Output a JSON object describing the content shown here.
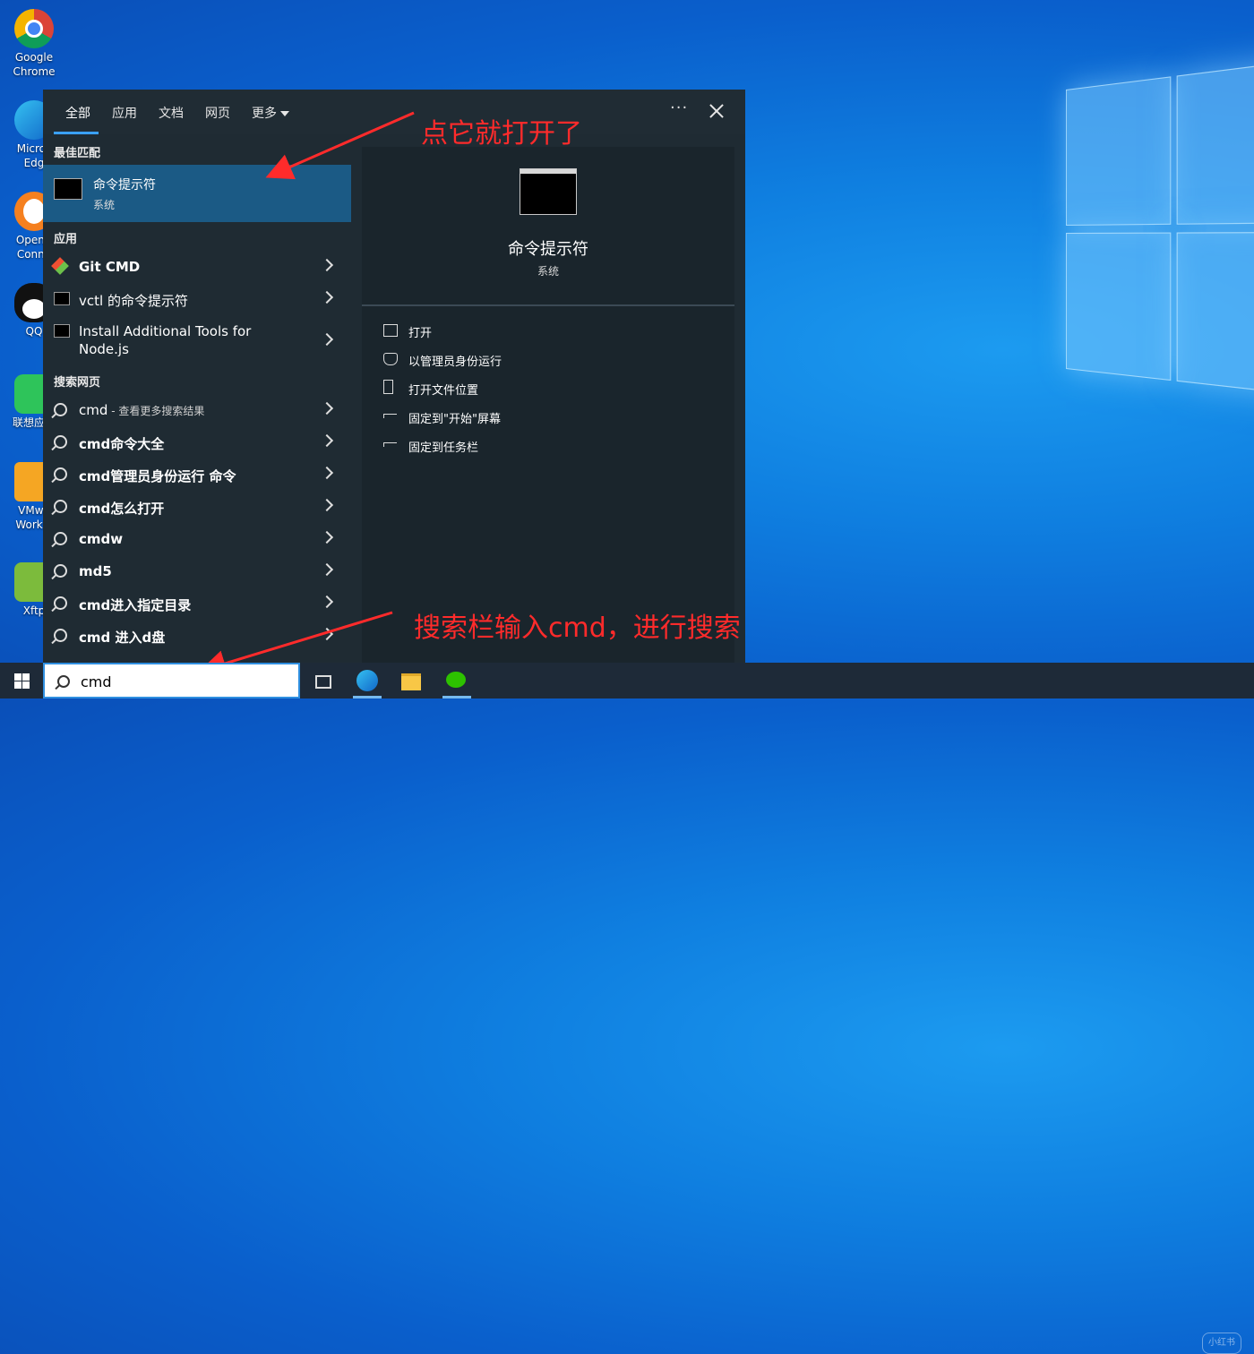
{
  "desktop": {
    "icons": [
      {
        "label": "Google Chrome"
      },
      {
        "label": "Micros Edg"
      },
      {
        "label": "OpenV Conne"
      },
      {
        "label": "QQ"
      },
      {
        "label": "联想应用"
      },
      {
        "label": "VMwa Workst"
      },
      {
        "label": "Xftp"
      }
    ]
  },
  "search_panel": {
    "tabs": [
      {
        "label": "全部",
        "active": true
      },
      {
        "label": "应用"
      },
      {
        "label": "文档"
      },
      {
        "label": "网页"
      },
      {
        "label": "更多"
      }
    ],
    "ellipsis": "···",
    "best_match": {
      "header": "最佳匹配",
      "title": "命令提示符",
      "subtitle": "系统"
    },
    "apps": {
      "header": "应用",
      "items": [
        {
          "label_bold": "Git CMD",
          "icon": "git-icon"
        },
        {
          "label": "vctl 的命令提示符",
          "icon": "cmd-icon"
        },
        {
          "label": "Install Additional Tools for Node.js",
          "icon": "cmd-icon"
        }
      ]
    },
    "web": {
      "header": "搜索网页",
      "items": [
        {
          "label": "cmd",
          "suffix": " - 查看更多搜索结果"
        },
        {
          "label": "cmd命令大全"
        },
        {
          "label": "cmd管理员身份运行 命令"
        },
        {
          "label": "cmd怎么打开"
        },
        {
          "label": "cmdw"
        },
        {
          "label": "md5"
        },
        {
          "label": "cmd进入指定目录"
        },
        {
          "label": "cmd 进入d盘"
        }
      ]
    },
    "preview": {
      "title": "命令提示符",
      "subtitle": "系统",
      "actions": [
        {
          "label": "打开",
          "icon": "open-icon"
        },
        {
          "label": "以管理员身份运行",
          "icon": "shield-icon"
        },
        {
          "label": "打开文件位置",
          "icon": "file-location-icon"
        },
        {
          "label": "固定到\"开始\"屏幕",
          "icon": "pin-icon"
        },
        {
          "label": "固定到任务栏",
          "icon": "pin-icon"
        }
      ]
    }
  },
  "annotations": {
    "top": "点它就打开了",
    "bottom": "搜索栏输入cmd，进行搜索"
  },
  "taskbar": {
    "search_value": "cmd",
    "watermark": "小红书"
  },
  "colors": {
    "accent": "#3aa0ff",
    "highlight": "#1b5a85",
    "annotation": "#ff2b2b"
  }
}
